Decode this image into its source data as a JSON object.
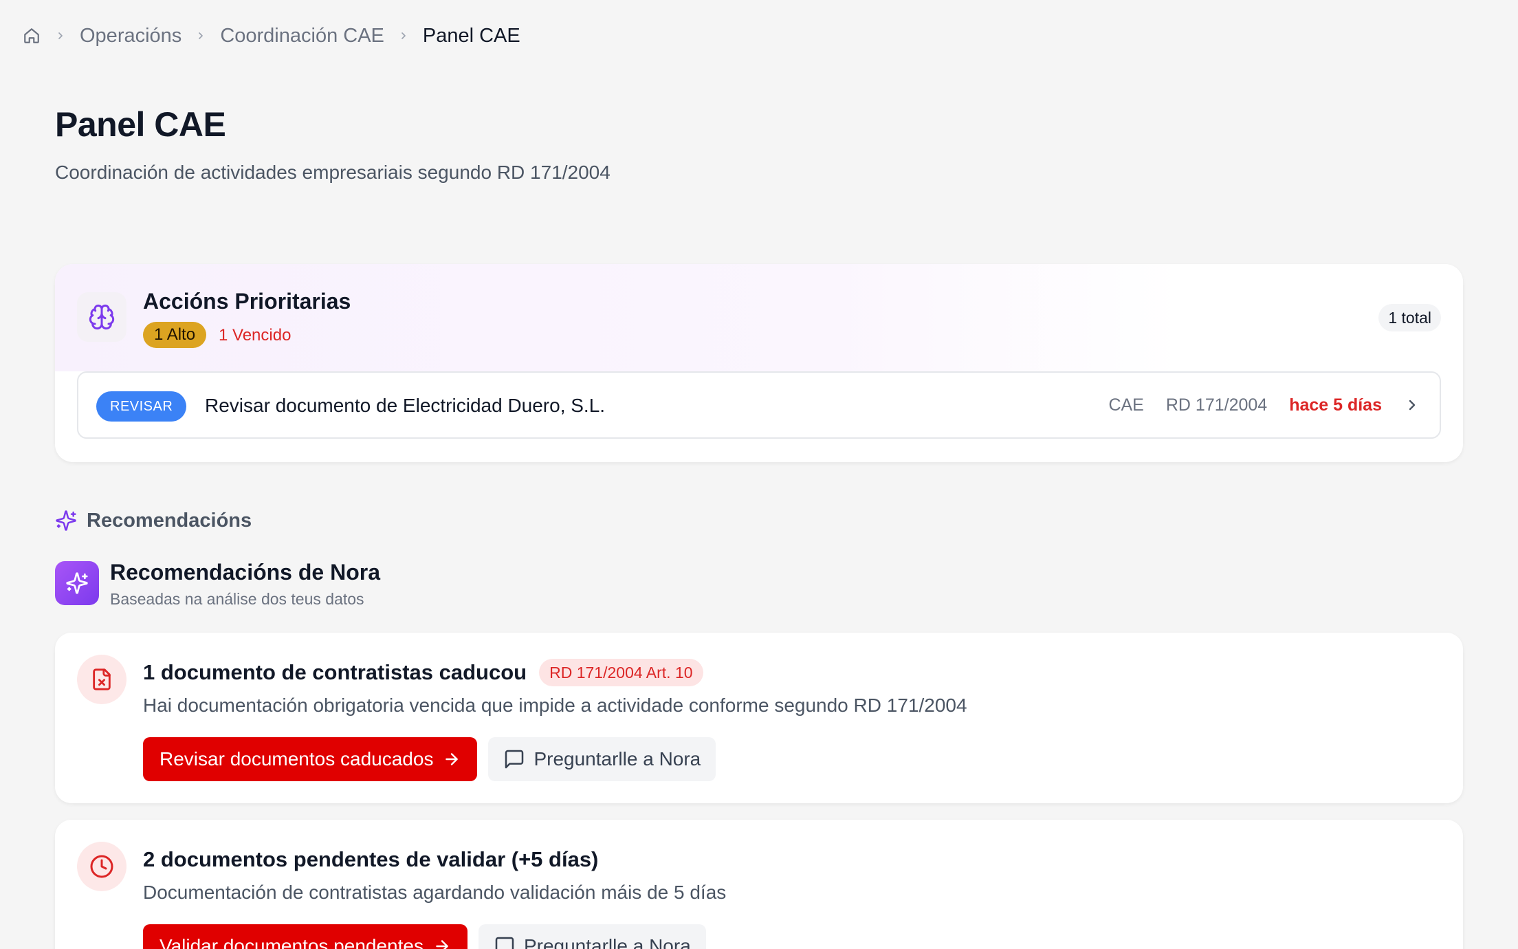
{
  "breadcrumb": {
    "items": [
      "Operacións",
      "Coordinación CAE"
    ],
    "current": "Panel CAE"
  },
  "header": {
    "title": "Panel CAE",
    "subtitle": "Coordinación de actividades empresariais segundo RD 171/2004"
  },
  "priority": {
    "title": "Accións Prioritarias",
    "high_badge": "1 Alto",
    "overdue": "1 Vencido",
    "total": "1 total",
    "action": {
      "tag": "REVISAR",
      "title": "Revisar documento de Electricidad Duero, S.L.",
      "module": "CAE",
      "regulation": "RD 171/2004",
      "ago": "hace 5 días"
    }
  },
  "recommendations": {
    "section_label": "Recomendacións",
    "title": "Recomendacións de Nora",
    "subtitle": "Baseadas na análise dos teus datos",
    "cards": [
      {
        "title": "1 documento de contratistas caducou",
        "reference": "RD 171/2004 Art. 10",
        "description": "Hai documentación obrigatoria vencida que impide a actividade conforme segundo RD 171/2004",
        "primary_label": "Revisar documentos caducados",
        "secondary_label": "Preguntarlle a Nora"
      },
      {
        "title": "2 documentos pendentes de validar (+5 días)",
        "description": "Documentación de contratistas agardando validación máis de 5 días",
        "primary_label": "Validar documentos pendentes",
        "secondary_label": "Preguntarlle a Nora"
      }
    ]
  },
  "colors": {
    "accent_red": "#e00000",
    "purple": "#7c3aed",
    "blue_tag": "#3b82f6",
    "amber_badge": "#dca421"
  }
}
